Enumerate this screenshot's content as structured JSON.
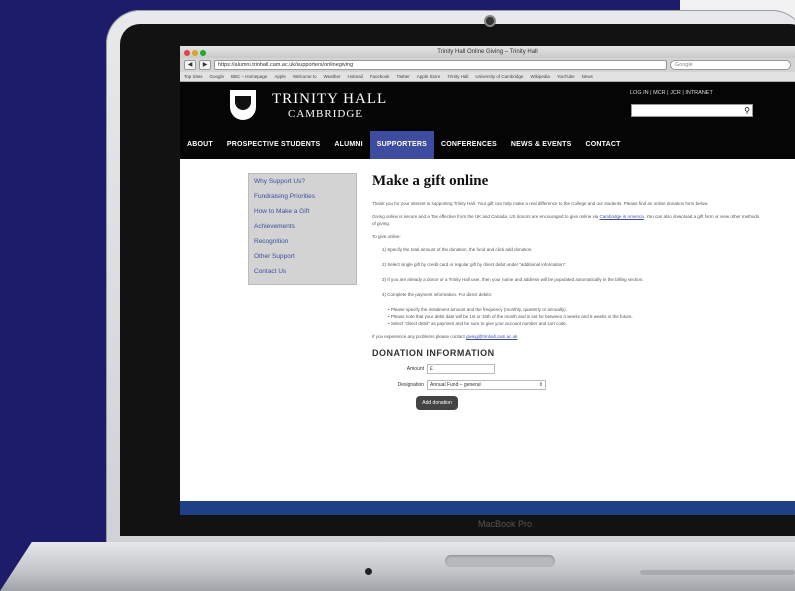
{
  "device": {
    "brand_label": "MacBook Pro"
  },
  "browser": {
    "window_title": "Trinity Hall Online Giving – Trinity Hall",
    "url": "https://alumni.trinhall.cam.ac.uk/supporters/onlinegiving",
    "search_placeholder": "Google",
    "back_glyph": "◀",
    "forward_glyph": "▶",
    "traffic_colors": [
      "#e0443e",
      "#dea123",
      "#1aab29"
    ],
    "bookmarks": [
      "Top Sites",
      "Google",
      "BBC – Homepage",
      "Apple",
      "Welcome to",
      "Weather",
      "Hotmail",
      "Facebook",
      "Twitter",
      "Apple Store",
      "Trinity Hall",
      "University of Cambridge",
      "Wikipedia",
      "YouTube",
      "News"
    ]
  },
  "site": {
    "logo_line1": "TRINITY HALL",
    "logo_line2": "CAMBRIDGE",
    "top_links": "LOG IN | MCR | JCR | INTRANET",
    "search_icon": "search-icon",
    "search_glyph": "⚲",
    "nav": [
      "ABOUT",
      "PROSPECTIVE STUDENTS",
      "ALUMNI",
      "SUPPORTERS",
      "CONFERENCES",
      "NEWS & EVENTS",
      "CONTACT"
    ],
    "nav_active_index": 3,
    "accent_color": "#3e4ca0"
  },
  "sidebar": {
    "items": [
      "Why Support Us?",
      "Fundraising Priorities",
      "How to Make a Gift",
      "Achievements",
      "Recognition",
      "Other Support",
      "Contact Us"
    ]
  },
  "main": {
    "title": "Make a gift online",
    "intro": "Thank you for your interest in supporting Trinity Hall. Your gift can help make a real difference to the College and our students. Please find an online donation form below.",
    "secure_text": "Giving online is secure and a Tax effective from the UK and Canada. US donors are encouraged to give online via",
    "secure_link": "Cambridge in America",
    "secure_tail": ". You can also download a gift form or view other methods of giving.",
    "to_give": "To give online:",
    "steps": [
      "1) Specify the total amount of the donation, the fund and click add donation.",
      "2) Select single gift by credit card or regular gift by direct debit under \"additional information\".",
      "3) If you are already a donor or a Trinity Hall user, then your name and address will be populated automatically in the billing section.",
      "4) Complete the payment information. For direct debits:"
    ],
    "bullets": [
      "Please specify the instalment amount and the frequency (monthly, quarterly or annually).",
      "Please note that your debit date will be 1st or 15th of the month and is set for between 4 weeks and 6 weeks in the future.",
      "Select \"direct debit\" as payment and be sure to give your account number and sort code."
    ],
    "problems": "If you experience any problems please contact",
    "problems_link": "giving@trinhall.cam.ac.uk",
    "donation_heading": "DONATION INFORMATION",
    "amount_label": "Amount",
    "amount_value": "£",
    "designation_label": "Designation",
    "designation_value": "Annual Fund – general",
    "dropdown_glyph": "⇕",
    "add_button": "Add donation"
  }
}
